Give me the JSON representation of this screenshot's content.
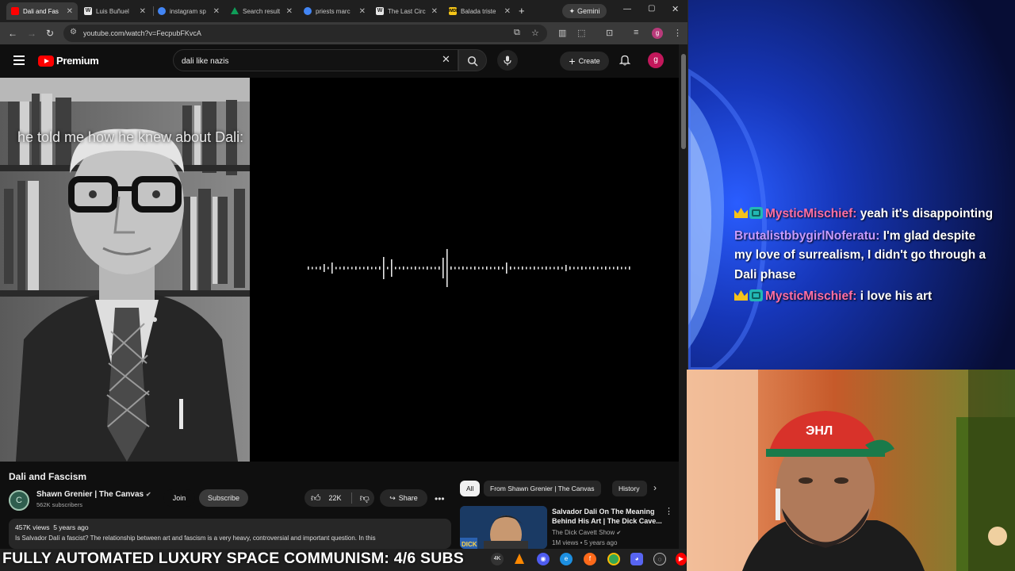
{
  "browser": {
    "tabs": [
      {
        "label": "Dali and Fas",
        "favicon_color": "#ff0000",
        "active": true
      },
      {
        "label": "Luis Buñuel",
        "favicon_color": "#dddddd",
        "glyph": "W"
      },
      {
        "label": "instagram sp",
        "favicon_color": "#4285f4"
      },
      {
        "label": "Search result",
        "favicon_color": "#0f9d58"
      },
      {
        "label": "priests marc",
        "favicon_color": "#4285f4"
      },
      {
        "label": "The Last Circ",
        "favicon_color": "#dddddd",
        "glyph": "W"
      },
      {
        "label": "Balada triste",
        "favicon_color": "#f5c518",
        "glyph": "IMDb"
      }
    ],
    "gemini_label": "Gemini",
    "url": "youtube.com/watch?v=FecpubFKvcA"
  },
  "youtube": {
    "logo_text": "Premium",
    "search_value": "dali like nazis",
    "create_label": "Create",
    "avatar_letter": "g",
    "caption": "he told me how he knew about Dali:",
    "video_title": "Dali and Fascism",
    "channel_name": "Shawn Grenier | The Canvas",
    "subscribers": "562K subscribers",
    "join_label": "Join",
    "subscribe_label": "Subscribe",
    "likes": "22K",
    "share_label": "Share",
    "views": "457K views",
    "age": "5 years ago",
    "description": "Is Salvador Dalí a fascist? The relationship between art and fascism is a very heavy, controversial and important question. In this",
    "chips": [
      "All",
      "From Shawn Grenier | The Canvas",
      "History"
    ],
    "rec": {
      "title": "Salvador Dali On The Meaning Behind His Art | The Dick Cave...",
      "channel": "The Dick Cavett Show",
      "meta": "1M views • 5 years ago",
      "thumb_text": "DICK"
    }
  },
  "chat": [
    {
      "user": "MysticMischief:",
      "text": "yeah it's disappointing",
      "badges": true,
      "color": "pink"
    },
    {
      "user": "BrutalistbbygirlNoferatu:",
      "text": "I'm glad despite my love of surrealism, I didn't go through a Dali phase",
      "badges": false,
      "color": "purple"
    },
    {
      "user": "MysticMischief:",
      "text": "i love his art",
      "badges": true,
      "color": "pink"
    }
  ],
  "ticker": "FULLY AUTOMATED LUXURY SPACE COMMUNISM: 4/6 SUBS",
  "taskbar_icons": [
    "4k-icon",
    "vlc-icon",
    "app-icon",
    "edge-icon",
    "firefox-icon",
    "chrome-icon",
    "discord-icon",
    "obs-icon",
    "youtube-icon"
  ]
}
